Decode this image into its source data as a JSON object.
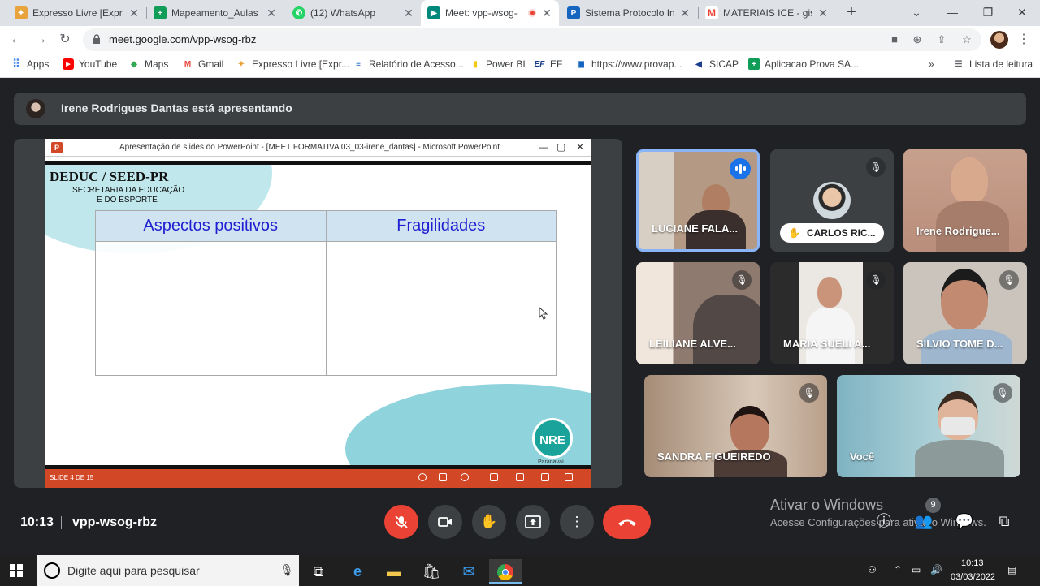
{
  "browser": {
    "tabs": [
      {
        "title": "Expresso Livre [Expres",
        "icon": "expresso-icon",
        "color": "#e8a33d"
      },
      {
        "title": "Mapeamento_Aulas c",
        "icon": "sheets-icon",
        "color": "#0f9d58"
      },
      {
        "title": "(12) WhatsApp",
        "icon": "whatsapp-icon",
        "color": "#25d366"
      },
      {
        "title": "Meet: vpp-wsog-",
        "icon": "meet-icon",
        "color": "#00897b"
      },
      {
        "title": "Sistema Protocolo Int",
        "icon": "protocolo-icon",
        "color": "#1565c0"
      },
      {
        "title": "MATERIAIS ICE - gisel",
        "icon": "gmail-icon",
        "color": "#ea4335"
      }
    ],
    "url": "meet.google.com/vpp-wsog-rbz",
    "bookmarks": [
      {
        "label": "Apps",
        "icon": "apps-grid-icon"
      },
      {
        "label": "YouTube",
        "icon": "youtube-icon"
      },
      {
        "label": "Maps",
        "icon": "maps-icon"
      },
      {
        "label": "Gmail",
        "icon": "gmail-icon"
      },
      {
        "label": "Expresso Livre [Expr...",
        "icon": "expresso-icon"
      },
      {
        "label": "Relatório de Acesso...",
        "icon": "report-icon"
      },
      {
        "label": "Power BI",
        "icon": "powerbi-icon"
      },
      {
        "label": "EF",
        "icon": "ef-icon"
      },
      {
        "label": "https://www.provap...",
        "icon": "web-icon"
      },
      {
        "label": "SICAP",
        "icon": "sicap-icon"
      },
      {
        "label": "Aplicacao Prova SA...",
        "icon": "sheets-icon"
      }
    ],
    "reading_list": "Lista de leitura"
  },
  "meet": {
    "presenting_text": "Irene Rodrigues Dantas está apresentando",
    "ppt": {
      "window_title": "Apresentação de slides do PowerPoint - [MEET FORMATIVA 03_03-irene_dantas] - Microsoft PowerPoint",
      "slide_org": "DEDUC / SEED-PR",
      "slide_sub1": "SECRETARIA DA EDUCAÇÃO",
      "slide_sub2": "E DO ESPORTE",
      "col1": "Aspectos positivos",
      "col2": "Fragilidades",
      "logo": "NRE",
      "logo_sub": "Paranavaí",
      "slide_number": "SLIDE 4 DE 15"
    },
    "participants": [
      {
        "name": "LUCIANE FALA...",
        "speaking": true
      },
      {
        "name": "CARLOS RIC...",
        "hand_raised": true
      },
      {
        "name": "Irene Rodrigue..."
      },
      {
        "name": "LEILIANE ALVE..."
      },
      {
        "name": "MARIA SUELI A..."
      },
      {
        "name": "SILVIO TOME D..."
      },
      {
        "name": "SANDRA FIGUEIREDO"
      },
      {
        "name": "Você"
      }
    ],
    "time": "10:13",
    "meeting_code": "vpp-wsog-rbz",
    "participant_count": "9",
    "activation_title": "Ativar o Windows",
    "activation_sub": "Acesse Configurações para ativar o Windows."
  },
  "taskbar": {
    "search_placeholder": "Digite aqui para pesquisar",
    "clock_time": "10:13",
    "clock_date": "03/03/2022"
  },
  "colors": {
    "accent": "#1a73e8",
    "danger": "#ea4335",
    "meet_bg": "#202124",
    "tile_bg": "#3c4043"
  }
}
